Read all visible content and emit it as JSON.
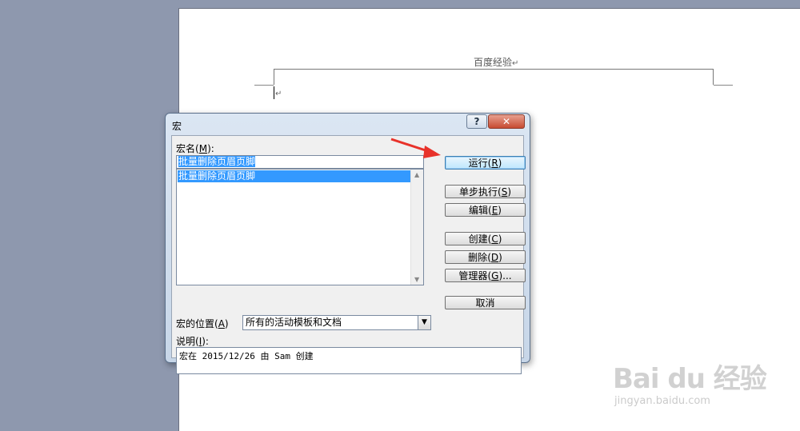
{
  "document": {
    "header_text": "百度经验",
    "paragraph_mark": "↵"
  },
  "dialog": {
    "title": "宏",
    "help_label": "?",
    "close_label": "✕",
    "macro_name_label": "宏名",
    "macro_name_key": "M",
    "macro_name_value": "批量删除页眉页脚",
    "macro_list": [
      "批量删除页眉页脚"
    ],
    "location_label": "宏的位置",
    "location_key": "A",
    "location_value": "所有的活动模板和文档",
    "description_label": "说明",
    "description_key": "I",
    "description_text": "宏在 2015/12/26 由 Sam 创建",
    "buttons": {
      "run": {
        "label": "运行",
        "key": "R"
      },
      "step": {
        "label": "单步执行",
        "key": "S"
      },
      "edit": {
        "label": "编辑",
        "key": "E"
      },
      "create": {
        "label": "创建",
        "key": "C"
      },
      "delete": {
        "label": "删除",
        "key": "D"
      },
      "organizer": {
        "label": "管理器",
        "key": "G",
        "suffix": "..."
      },
      "cancel": {
        "label": "取消"
      }
    }
  },
  "annotation": {
    "arrow_color": "#e8322a"
  },
  "watermark": {
    "brand": "Bai du 经验",
    "url": "jingyan.baidu.com"
  }
}
